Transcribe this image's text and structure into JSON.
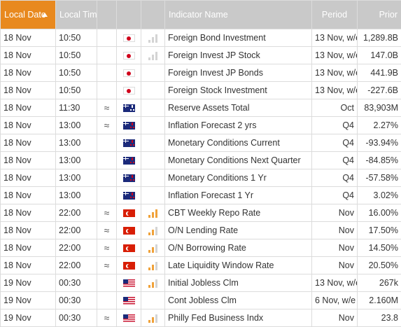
{
  "header": {
    "local_date": "Local Date",
    "local_time": "Local Time",
    "indicator_name": "Indicator Name",
    "period": "Period",
    "prior": "Prior"
  },
  "colors": {
    "header_sorted": "#e8891f",
    "header_plain": "#c9c9c9",
    "impact": "#f0a23a"
  },
  "rows": [
    {
      "date": "18 Nov",
      "time": "10:50",
      "approx": "",
      "flag": "japan-flag",
      "impact": "low",
      "name": "Foreign Bond Investment",
      "period": "13 Nov, w/e",
      "prior": "1,289.8B"
    },
    {
      "date": "18 Nov",
      "time": "10:50",
      "approx": "",
      "flag": "japan-flag",
      "impact": "low",
      "name": "Foreign Invest JP Stock",
      "period": "13 Nov, w/e",
      "prior": "147.0B"
    },
    {
      "date": "18 Nov",
      "time": "10:50",
      "approx": "",
      "flag": "japan-flag",
      "impact": "none",
      "name": "Foreign Invest JP Bonds",
      "period": "13 Nov, w/e",
      "prior": "441.9B"
    },
    {
      "date": "18 Nov",
      "time": "10:50",
      "approx": "",
      "flag": "japan-flag",
      "impact": "none",
      "name": "Foreign Stock Investment",
      "period": "13 Nov, w/e",
      "prior": "-227.6B"
    },
    {
      "date": "18 Nov",
      "time": "11:30",
      "approx": "≈",
      "flag": "australia-flag",
      "impact": "none",
      "name": "Reserve Assets Total",
      "period": "Oct",
      "prior": "83,903M"
    },
    {
      "date": "18 Nov",
      "time": "13:00",
      "approx": "≈",
      "flag": "new-zealand-flag",
      "impact": "none",
      "name": "Inflation Forecast 2 yrs",
      "period": "Q4",
      "prior": "2.27%"
    },
    {
      "date": "18 Nov",
      "time": "13:00",
      "approx": "",
      "flag": "new-zealand-flag",
      "impact": "none",
      "name": "Monetary Conditions Current",
      "period": "Q4",
      "prior": "-93.94%"
    },
    {
      "date": "18 Nov",
      "time": "13:00",
      "approx": "",
      "flag": "new-zealand-flag",
      "impact": "none",
      "name": "Monetary Conditions Next Quarter",
      "period": "Q4",
      "prior": "-84.85%"
    },
    {
      "date": "18 Nov",
      "time": "13:00",
      "approx": "",
      "flag": "new-zealand-flag",
      "impact": "none",
      "name": "Monetary Conditions 1 Yr",
      "period": "Q4",
      "prior": "-57.58%"
    },
    {
      "date": "18 Nov",
      "time": "13:00",
      "approx": "",
      "flag": "new-zealand-flag",
      "impact": "none",
      "name": "Inflation Forecast 1 Yr",
      "period": "Q4",
      "prior": "3.02%"
    },
    {
      "date": "18 Nov",
      "time": "22:00",
      "approx": "≈",
      "flag": "turkey-flag",
      "impact": "high",
      "name": "CBT Weekly Repo Rate",
      "period": "Nov",
      "prior": "16.00%"
    },
    {
      "date": "18 Nov",
      "time": "22:00",
      "approx": "≈",
      "flag": "turkey-flag",
      "impact": "medium",
      "name": "O/N Lending Rate",
      "period": "Nov",
      "prior": "17.50%"
    },
    {
      "date": "18 Nov",
      "time": "22:00",
      "approx": "≈",
      "flag": "turkey-flag",
      "impact": "medium",
      "name": "O/N Borrowing Rate",
      "period": "Nov",
      "prior": "14.50%"
    },
    {
      "date": "18 Nov",
      "time": "22:00",
      "approx": "≈",
      "flag": "turkey-flag",
      "impact": "medium",
      "name": "Late Liquidity Window Rate",
      "period": "Nov",
      "prior": "20.50%"
    },
    {
      "date": "19 Nov",
      "time": "00:30",
      "approx": "",
      "flag": "usa-flag",
      "impact": "medium",
      "name": "Initial Jobless Clm",
      "period": "13 Nov, w/e",
      "prior": "267k"
    },
    {
      "date": "19 Nov",
      "time": "00:30",
      "approx": "",
      "flag": "usa-flag",
      "impact": "none",
      "name": "Cont Jobless Clm",
      "period": "6 Nov, w/e",
      "prior": "2.160M"
    },
    {
      "date": "19 Nov",
      "time": "00:30",
      "approx": "≈",
      "flag": "usa-flag",
      "impact": "medium",
      "name": "Philly Fed Business Indx",
      "period": "Nov",
      "prior": "23.8"
    }
  ]
}
